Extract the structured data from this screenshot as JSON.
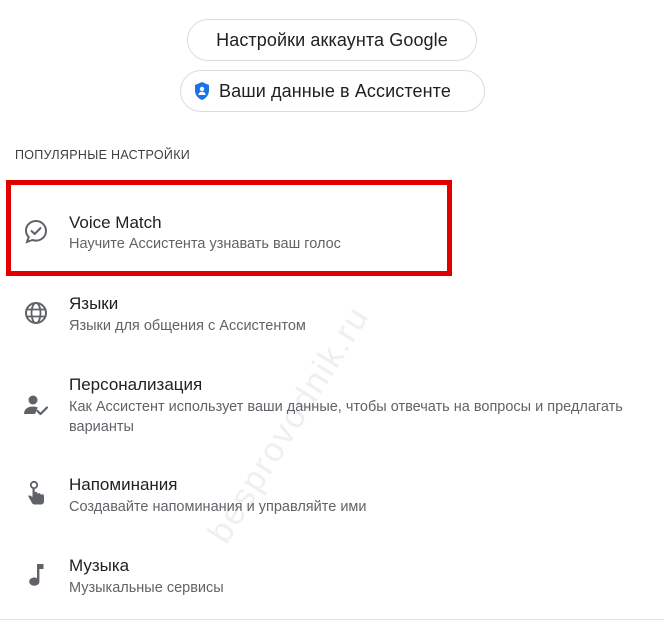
{
  "header": {
    "google_account_label": "Настройки аккаунта Google",
    "assistant_data_label": "Ваши данные в Ассистенте"
  },
  "section": {
    "title": "ПОПУЛЯРНЫЕ НАСТРОЙКИ"
  },
  "items": [
    {
      "title": "Voice Match",
      "subtitle": "Научите Ассистента узнавать ваш голос",
      "icon": "voice-match-icon"
    },
    {
      "title": "Языки",
      "subtitle": "Языки для общения с Ассистентом",
      "icon": "globe-icon"
    },
    {
      "title": "Персонализация",
      "subtitle": "Как Ассистент использует ваши данные, чтобы отвечать на вопросы и предлагать варианты",
      "icon": "person-check-icon"
    },
    {
      "title": "Напоминания",
      "subtitle": "Создавайте напоминания и управляйте ими",
      "icon": "reminder-hand-icon"
    },
    {
      "title": "Музыка",
      "subtitle": "Музыкальные сервисы",
      "icon": "music-note-icon"
    }
  ],
  "watermark": "besprovodnik.ru",
  "colors": {
    "highlight": "#e10000",
    "shield": "#1a73e8",
    "text_primary": "#202124",
    "text_secondary": "#5f6368"
  }
}
